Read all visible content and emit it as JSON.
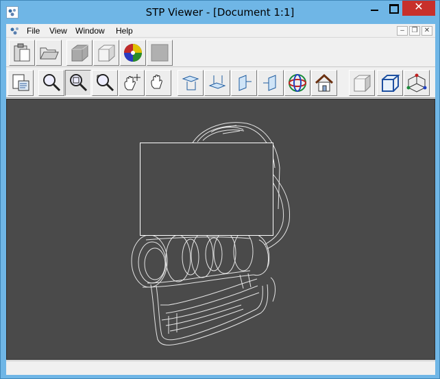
{
  "window": {
    "title": "STP Viewer - [Document 1:1]",
    "controls": {
      "minimize": "minimize",
      "maximize": "maximize",
      "close": "✕"
    }
  },
  "menubar": {
    "items": [
      {
        "label": "File"
      },
      {
        "label": "View"
      },
      {
        "label": "Window"
      },
      {
        "label": "Help"
      }
    ],
    "mdi_controls": {
      "minimize": "–",
      "restore": "❐",
      "close": "✕"
    }
  },
  "toolbar_main": {
    "buttons": [
      {
        "icon": "paste-icon"
      },
      {
        "icon": "open-folder-icon"
      },
      {
        "icon": "shaded-cube-gray-icon"
      },
      {
        "icon": "shaded-cube-white-icon"
      },
      {
        "icon": "color-wheel-icon"
      },
      {
        "icon": "blank-disabled-icon"
      }
    ]
  },
  "toolbar_view": {
    "buttons": [
      {
        "icon": "document-select-icon"
      },
      {
        "icon": "zoom-icon"
      },
      {
        "icon": "zoom-window-icon",
        "pressed": true
      },
      {
        "icon": "zoom-dynamic-icon"
      },
      {
        "icon": "pan-icon"
      },
      {
        "icon": "rotate-hand-icon"
      },
      {
        "icon": "top-view-icon"
      },
      {
        "icon": "bottom-view-icon"
      },
      {
        "icon": "left-view-icon"
      },
      {
        "icon": "right-view-icon"
      },
      {
        "icon": "axis-sphere-icon"
      },
      {
        "icon": "home-view-icon"
      },
      {
        "icon": "shaded-mode-icon"
      },
      {
        "icon": "wireframe-mode-icon"
      },
      {
        "icon": "axis-triad-icon"
      }
    ]
  },
  "viewport": {
    "background": "#4a4a4a",
    "wire_color": "#e8e8e8"
  },
  "statusbar": {
    "text": ""
  }
}
